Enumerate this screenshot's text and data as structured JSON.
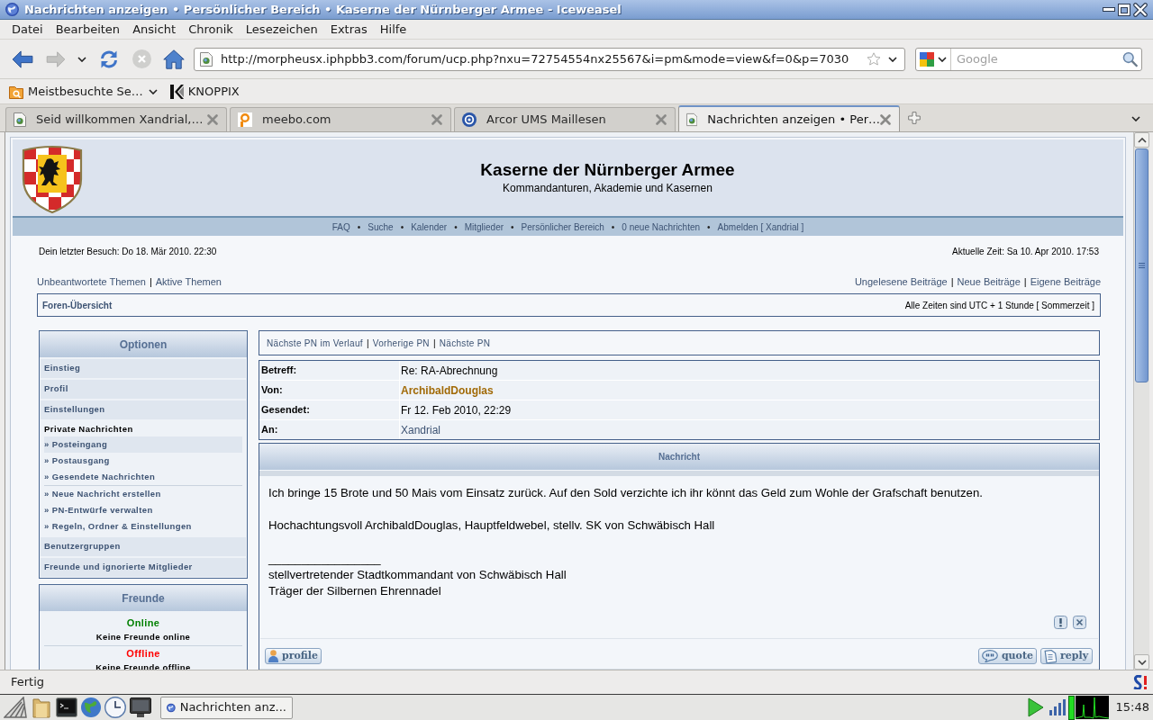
{
  "window": {
    "title": "Nachrichten anzeigen • Persönlicher Bereich • Kaserne der Nürnberger Armee - Iceweasel"
  },
  "menu": [
    "Datei",
    "Bearbeiten",
    "Ansicht",
    "Chronik",
    "Lesezeichen",
    "Extras",
    "Hilfe"
  ],
  "navigation": {
    "address": "http://morpheusx.iphpbb3.com/forum/ucp.php?nxu=72754554nx25567&i=pm&mode=view&f=0&p=7030",
    "search": {
      "placeholder": "Google"
    }
  },
  "bookmarks": [
    {
      "kind": "folder",
      "label": "Meistbesuchte Se…"
    },
    {
      "kind": "logo",
      "label": "KNOPPIX"
    }
  ],
  "tabs": [
    {
      "kind": "page",
      "label": "Seid willkommen Xandrial,…",
      "selected": false
    },
    {
      "kind": "ring",
      "label": "meebo.com",
      "selected": false
    },
    {
      "kind": "at",
      "label": "Arcor UMS Maillesen",
      "selected": false
    },
    {
      "kind": "page",
      "label": "Nachrichten anzeigen • Per…",
      "selected": true
    }
  ],
  "forum": {
    "title": "Kaserne der Nürnberger Armee",
    "subtitle": "Kommandanturen, Akademie und Kasernen",
    "navbar": {
      "separator": "•",
      "links": [
        "FAQ",
        "Suche",
        "Kalender",
        "Mitglieder",
        "Persönlicher Bereich",
        "0 neue Nachrichten",
        "Abmelden [ Xandrial ]"
      ]
    },
    "last_visit": "Dein letzter Besuch: Do 18. Mär 2010. 22:30",
    "current_time": "Aktuelle Zeit: Sa 10. Apr 2010. 17:53",
    "quick_links": {
      "separator": "|",
      "left": [
        "Unbeantwortete Themen",
        "Aktive Themen"
      ],
      "right": [
        "Ungelesene Beiträge",
        "Neue Beiträge",
        "Eigene Beiträge"
      ]
    },
    "breadcrumb": "Foren-Übersicht",
    "timezone": "Alle Zeiten sind UTC + 1 Stunde [ Sommerzeit ]"
  },
  "options": {
    "title": "Optionen",
    "sections_top": [
      "Einstieg",
      "Profil",
      "Einstellungen"
    ],
    "private_messages": {
      "heading": "Private Nachrichten",
      "groups": [
        {
          "items": [
            {
              "label": "» Posteingang",
              "selected": true
            },
            {
              "label": "» Postausgang",
              "selected": false
            },
            {
              "label": "» Gesendete Nachrichten",
              "selected": false
            }
          ]
        },
        {
          "items": [
            {
              "label": "» Neue Nachricht erstellen",
              "selected": false
            },
            {
              "label": "» PN-Entwürfe verwalten",
              "selected": false
            },
            {
              "label": "» Regeln, Ordner & Einstellungen",
              "selected": false
            }
          ]
        }
      ]
    },
    "sections_bottom": [
      "Benutzergruppen",
      "Freunde und ignorierte Mitglieder"
    ]
  },
  "friends": {
    "title": "Freunde",
    "groups": [
      {
        "label": "Online",
        "color": "#008000",
        "note": "Keine Freunde online"
      },
      {
        "label": "Offline",
        "color": "#ff0000",
        "note": "Keine Freunde offline"
      }
    ]
  },
  "pm_navigation": {
    "separator": "|",
    "links": [
      "Nächste PN im Verlauf",
      "Vorherige PN",
      "Nächste PN"
    ]
  },
  "pm_header": [
    {
      "kind": "text",
      "label": "Betreff:",
      "value": "Re: RA-Abrechnung"
    },
    {
      "kind": "author",
      "label": "Von:",
      "value": "ArchibaldDouglas"
    },
    {
      "kind": "text",
      "label": "Gesendet:",
      "value": "Fr 12. Feb 2010, 22:29"
    },
    {
      "kind": "link",
      "label": "An:",
      "value": "Xandrial"
    }
  ],
  "message": {
    "title": "Nachricht",
    "paragraphs": [
      "Ich bringe 15 Brote und 50 Mais vom Einsatz zurück. Auf den Sold verzichte ich ihr könnt das Geld zum Wohle der Grafschaft benutzen.",
      "Hochachtungsvoll ArchibaldDouglas, Hauptfeldwebel, stellv. SK von Schwäbisch Hall"
    ],
    "signature_rule": "_________________",
    "signature": [
      "stellvertretender Stadtkommandant von Schwäbisch Hall",
      "Träger der Silbernen Ehrennadel"
    ],
    "buttons": [
      {
        "kind": "profile",
        "label": "profile"
      },
      {
        "kind": "quote",
        "label": "quote"
      },
      {
        "kind": "reply",
        "label": "reply"
      }
    ]
  },
  "status_bar": {
    "text": "Fertig"
  },
  "taskbar": {
    "tasks": [
      {
        "label": "Nachrichten anz..."
      }
    ],
    "clock": "15:48"
  }
}
